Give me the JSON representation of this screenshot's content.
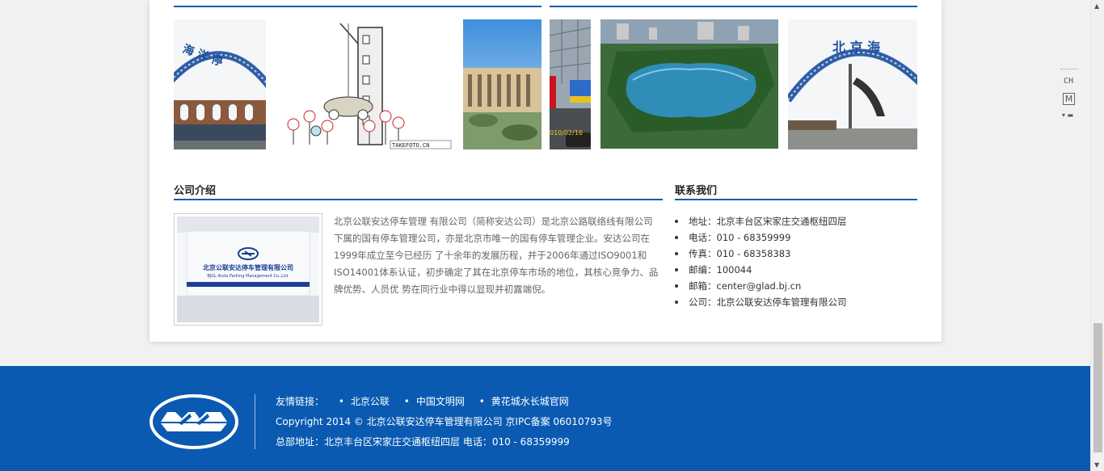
{
  "gallery": {
    "images": [
      {
        "name": "gate-arch-photo-1",
        "desc": "arch"
      },
      {
        "name": "parking-cartoon",
        "desc": "cartoon"
      },
      {
        "name": "plaza-building-photo",
        "desc": "building"
      },
      {
        "name": "street-shop-photo",
        "desc": "street"
      },
      {
        "name": "lake-aerial-photo",
        "desc": "lake"
      },
      {
        "name": "gate-arch-photo-2",
        "desc": "arch"
      }
    ],
    "watermark_cartoon": "TAKEFOTO.CN",
    "street_date": "010/02/16",
    "arch_text_1": "海 洋 停",
    "arch_text_2": "北 京 海"
  },
  "intro": {
    "title": "公司介绍",
    "sign_name": "北京公联安达停车管理有限公司",
    "sign_name_en": "BJGL Anda Parking Management Co.,Ltd.",
    "text": "北京公联安达停车管理 有限公司（简称安达公司）是北京公路联络线有限公司下属的国有停车管理公司，亦是北京市唯一的国有停车管理企业。安达公司在1999年成立至今已经历 了十余年的发展历程，并于2006年通过ISO9001和ISO14001体系认证，初步确定了其在北京停车市场的地位，其核心竞争力、品牌优势、人员优 势在同行业中得以显现并初露端倪。"
  },
  "contact": {
    "title": "联系我们",
    "items": [
      "地址：北京丰台区宋家庄交通枢纽四层",
      "电话：010 - 68359999",
      "传真：010 - 68358383",
      "邮编：100044",
      "邮箱：center@glad.bj.cn",
      "公司：北京公联安达停车管理有限公司"
    ]
  },
  "footer": {
    "links_label": "友情链接：",
    "links": [
      "北京公联",
      "中国文明网",
      "黄花城水长城官网"
    ],
    "copyright": "Copyright 2014 © 北京公联安达停车管理有限公司 京IPC备案 06010793号",
    "address": "总部地址：北京丰台区宋家庄交通枢纽四层 电话：010 - 68359999",
    "colors": {
      "background": "#0a5ab2",
      "text": "#ffffff"
    }
  },
  "ime": {
    "mode": "CH",
    "key": "M"
  },
  "colors": {
    "accent": "#0b5bb3"
  }
}
